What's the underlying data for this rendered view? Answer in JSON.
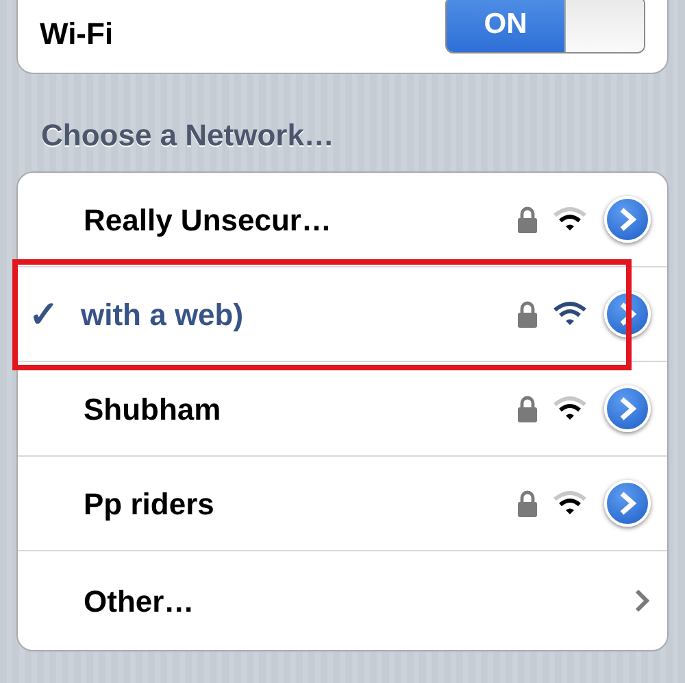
{
  "wifi": {
    "label": "Wi-Fi",
    "on": true,
    "on_text": "ON"
  },
  "section_header": "Choose a Network…",
  "networks": [
    {
      "name": "Really Unsecur…",
      "selected": false,
      "highlighted": false
    },
    {
      "name": "with a web)",
      "selected": true,
      "highlighted": true,
      "check": "✓"
    },
    {
      "name": "Shubham",
      "selected": false,
      "highlighted": false
    },
    {
      "name": "Pp riders",
      "selected": false,
      "highlighted": false
    }
  ],
  "other": {
    "label": "Other…"
  }
}
